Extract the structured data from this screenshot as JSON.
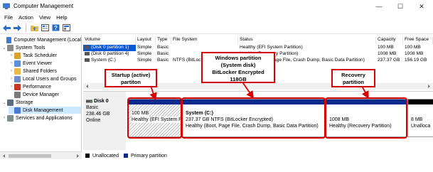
{
  "window": {
    "title": "Computer Management",
    "minimize": "—",
    "maximize": "☐",
    "close": "✕"
  },
  "menu": [
    "File",
    "Action",
    "View",
    "Help"
  ],
  "tree": {
    "items": [
      {
        "label": "Computer Management (Local",
        "icon": "computer-icon",
        "chev": ""
      },
      {
        "label": "System Tools",
        "icon": "tools-icon",
        "chev": "⌄"
      },
      {
        "label": "Task Scheduler",
        "icon": "clock-icon",
        "chev": "›"
      },
      {
        "label": "Event Viewer",
        "icon": "event-viewer-icon",
        "chev": "›"
      },
      {
        "label": "Shared Folders",
        "icon": "folder-icon",
        "chev": "›"
      },
      {
        "label": "Local Users and Groups",
        "icon": "users-icon",
        "chev": "›"
      },
      {
        "label": "Performance",
        "icon": "performance-icon",
        "chev": "›"
      },
      {
        "label": "Device Manager",
        "icon": "device-manager-icon",
        "chev": ""
      },
      {
        "label": "Storage",
        "icon": "storage-icon",
        "chev": "⌄"
      },
      {
        "label": "Disk Management",
        "icon": "disk-icon",
        "chev": ""
      },
      {
        "label": "Services and Applications",
        "icon": "services-icon",
        "chev": "›"
      }
    ]
  },
  "volumes": {
    "columns": [
      "Volume",
      "Layout",
      "Type",
      "File System",
      "Status",
      "Capacity",
      "Free Space"
    ],
    "rows": [
      {
        "volume": "(Disk 0 partition 1)",
        "layout": "Simple",
        "type": "Basic",
        "fs": "",
        "status": "Healthy (EFI System Partition)",
        "capacity": "100 MB",
        "free": "100 MB"
      },
      {
        "volume": "(Disk 0 partition 4)",
        "layout": "Simple",
        "type": "Basic",
        "fs": "",
        "status": "Healthy (Recovery Partition)",
        "capacity": "1008 MB",
        "free": "1008 MB"
      },
      {
        "volume": "System (C:)",
        "layout": "Simple",
        "type": "Basic",
        "fs": "NTFS (BitLoc",
        "status": "Healthy (Boot, Page File, Crash Dump, Basic Data Partition)",
        "capacity": "237.37 GB",
        "free": "156.19 GB"
      }
    ]
  },
  "disk": {
    "name": "Disk 0",
    "type": "Basic",
    "size": "238.46 GB",
    "state": "Online",
    "partitions": [
      {
        "line1": "100 MB",
        "line2": "Healthy (EFI System P",
        "title": ""
      },
      {
        "title": "System  (C:)",
        "line1": "237.37 GB NTFS (BitLocker Encrypted)",
        "line2": "Healthy (Boot, Page File, Crash Dump, Basic Data Partition)"
      },
      {
        "title": "",
        "line1": "1008 MB",
        "line2": "Healthy (Recovery Partition)"
      },
      {
        "title": "",
        "line1": "8 MB",
        "line2": "Unalloca"
      }
    ]
  },
  "legend": {
    "unallocated": "Unallocated",
    "primary": "Primary partition"
  },
  "callouts": {
    "startup": "Startup (active)\npartiton",
    "windows": "Windows partition\n(System disk)\nBitLocker Encrypted\n118GB",
    "recovery": "Recovery\npartition"
  },
  "colors": {
    "primary": "#0a2a8e",
    "unallocated": "#000000",
    "callout": "#d80000",
    "selection": "#cce8ff"
  }
}
